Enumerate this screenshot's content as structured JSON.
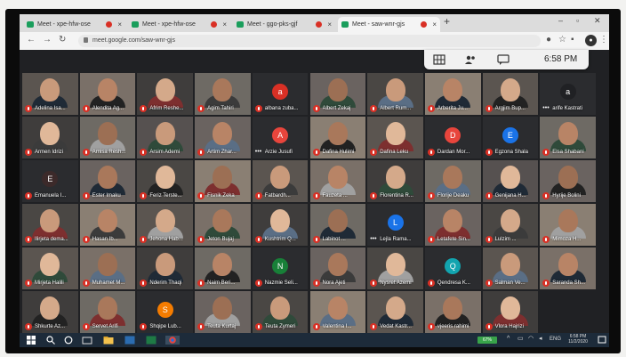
{
  "browser": {
    "tabs": [
      {
        "title": "Meet - xpe-hfw-ose"
      },
      {
        "title": "Meet - xpe-hfw-ose"
      },
      {
        "title": "Meet - ggo-pks-gjf"
      },
      {
        "title": "Meet - saw-wnr-gjs"
      }
    ],
    "new_tab": "+",
    "url": "meet.google.com/saw-wnr-gjs"
  },
  "meet": {
    "time": "6:58 PM",
    "participants": [
      {
        "name": "Adelina Isa...",
        "video": true
      },
      {
        "name": "Alendita Ag...",
        "video": true
      },
      {
        "name": "Afrim Reshe...",
        "video": true
      },
      {
        "name": "Agim Tahiri",
        "video": true
      },
      {
        "name": "albana zuba...",
        "letter": "a",
        "color": "#d93025"
      },
      {
        "name": "Albert Zekaj",
        "video": true
      },
      {
        "name": "Albert Rum...",
        "video": true
      },
      {
        "name": "Arberita Ju...",
        "video": true
      },
      {
        "name": "Argjim Bup...",
        "video": true
      },
      {
        "name": "arife Kastrati",
        "letter": "a",
        "color": "#202124",
        "muted": false
      },
      {
        "name": "Armen Idrizi",
        "video": true
      },
      {
        "name": "Arnisa Resh...",
        "video": true
      },
      {
        "name": "Arsim Ademi",
        "video": true
      },
      {
        "name": "Artim Zhar...",
        "video": true
      },
      {
        "name": "Arzie Jusufi",
        "letter": "A",
        "color": "#e8453c",
        "muted": false
      },
      {
        "name": "Dafina Hulimi",
        "video": true
      },
      {
        "name": "Dafina Leku",
        "video": true
      },
      {
        "name": "Dardan Mor...",
        "letter": "D",
        "color": "#e8453c"
      },
      {
        "name": "Egzona Shala",
        "letter": "E",
        "color": "#1a73e8"
      },
      {
        "name": "Elsa Shabani",
        "video": true
      },
      {
        "name": "Emanuela I...",
        "letter": "E",
        "color": "#3c2a2a"
      },
      {
        "name": "Ester Imaku",
        "video": true
      },
      {
        "name": "Feriz Terste...",
        "video": true
      },
      {
        "name": "Fisnik Zeka",
        "video": true
      },
      {
        "name": "Fatbardh...",
        "video": true
      },
      {
        "name": "Fauzeta ...",
        "video": true
      },
      {
        "name": "Florentina R...",
        "video": true
      },
      {
        "name": "Florije Deaku",
        "video": true
      },
      {
        "name": "Genijana H...",
        "video": true
      },
      {
        "name": "Hyrije Bolini",
        "video": true
      },
      {
        "name": "Ilirjeta dema...",
        "video": true
      },
      {
        "name": "Hasan Ib...",
        "video": true
      },
      {
        "name": "Jehona Hab...",
        "video": true
      },
      {
        "name": "Jeton Bujaj",
        "video": true
      },
      {
        "name": "Kushtrim Q...",
        "video": true
      },
      {
        "name": "Labinot ...",
        "video": true
      },
      {
        "name": "Lejla Rama...",
        "letter": "L",
        "color": "#1a73e8",
        "muted": false
      },
      {
        "name": "Letafete Sin...",
        "video": true
      },
      {
        "name": "Lulzim ...",
        "video": true
      },
      {
        "name": "Mimoza H...",
        "video": true
      },
      {
        "name": "Mirjeta Halili",
        "video": true
      },
      {
        "name": "Muhamet M...",
        "video": true
      },
      {
        "name": "Nderim Thaqi",
        "video": true
      },
      {
        "name": "Naim Beri...",
        "video": true
      },
      {
        "name": "Nazmie Seli...",
        "letter": "N",
        "color": "#188038"
      },
      {
        "name": "Nora Ajeti",
        "video": true
      },
      {
        "name": "Nysret Azemi",
        "video": true
      },
      {
        "name": "Qendresa K...",
        "letter": "Q",
        "color": "#12a4af"
      },
      {
        "name": "Salman Ve...",
        "video": true
      },
      {
        "name": "Saranda Sh...",
        "video": true
      },
      {
        "name": "Shkurte Az...",
        "video": true
      },
      {
        "name": "Servet Arifi",
        "video": true
      },
      {
        "name": "Shqipe Lub...",
        "letter": "S",
        "color": "#f57c00"
      },
      {
        "name": "Teuta Kurtaj",
        "video": true
      },
      {
        "name": "Teuta Zymeri",
        "video": true
      },
      {
        "name": "Valentina I...",
        "video": true
      },
      {
        "name": "Vedat Kastr...",
        "video": true
      },
      {
        "name": "vjeeris rahimi",
        "video": true
      },
      {
        "name": "Vlora Hajrizi",
        "video": true
      }
    ]
  },
  "taskbar": {
    "battery": "67%",
    "clock_time": "6:58 PM",
    "clock_date": "11/2/2020"
  },
  "colors": {
    "meet_bg": "#202124",
    "mic_off": "#d93025",
    "taskbar": "#1d2b3a",
    "tab_strip": "#dcdcdc"
  }
}
